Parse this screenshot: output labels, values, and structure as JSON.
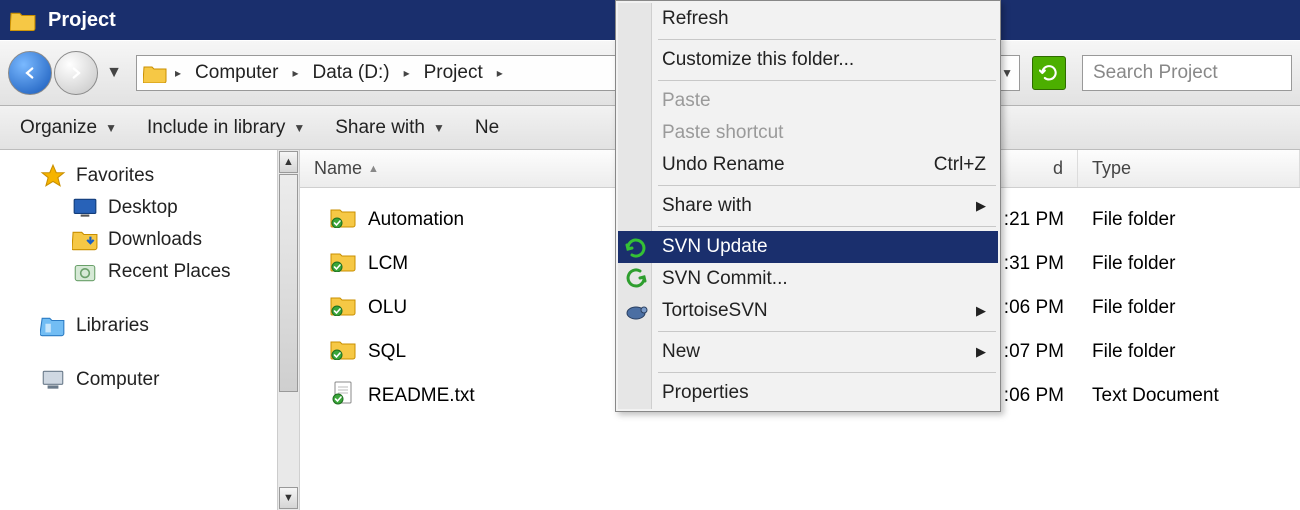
{
  "title": "Project",
  "breadcrumb": {
    "segments": [
      "Computer",
      "Data (D:)",
      "Project"
    ]
  },
  "search": {
    "placeholder": "Search Project"
  },
  "toolbar": {
    "organize": "Organize",
    "include": "Include in library",
    "share": "Share with",
    "new_truncated": "Ne"
  },
  "sidebar": {
    "favorites": "Favorites",
    "desktop": "Desktop",
    "downloads": "Downloads",
    "recent": "Recent Places",
    "libraries": "Libraries",
    "computer": "Computer"
  },
  "columns": {
    "name": "Name",
    "date_suffix": "d",
    "type": "Type"
  },
  "files": [
    {
      "name": "Automation",
      "date_tail": ":21 PM",
      "type": "File folder",
      "icon": "folder-svn"
    },
    {
      "name": "LCM",
      "date_tail": ":31 PM",
      "type": "File folder",
      "icon": "folder-svn"
    },
    {
      "name": "OLU",
      "date_tail": ":06 PM",
      "type": "File folder",
      "icon": "folder-svn"
    },
    {
      "name": "SQL",
      "date_tail": ":07 PM",
      "type": "File folder",
      "icon": "folder-svn"
    },
    {
      "name": "README.txt",
      "date_tail": ":06 PM",
      "type": "Text Document",
      "icon": "file-svn"
    }
  ],
  "context_menu": {
    "refresh": "Refresh",
    "customize": "Customize this folder...",
    "paste": "Paste",
    "paste_shortcut": "Paste shortcut",
    "undo_rename": "Undo Rename",
    "undo_shortcut": "Ctrl+Z",
    "share_with": "Share with",
    "svn_update": "SVN Update",
    "svn_commit": "SVN Commit...",
    "tortoise": "TortoiseSVN",
    "new": "New",
    "properties": "Properties"
  }
}
